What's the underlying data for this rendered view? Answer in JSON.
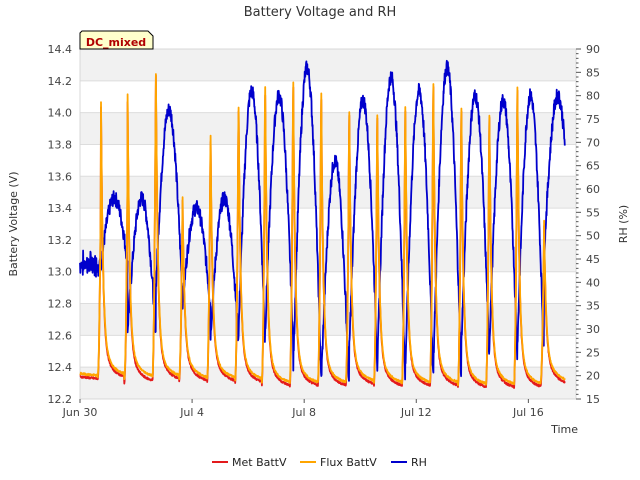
{
  "chart_data": {
    "type": "line",
    "title": "Battery Voltage and RH",
    "badge": "DC_mixed",
    "xlabel": "Time",
    "ylabel_left": "Battery Voltage (V)",
    "ylabel_right": "RH (%)",
    "x_ticks": [
      "Jun 30",
      "Jul 4",
      "Jul 8",
      "Jul 12",
      "Jul 16"
    ],
    "x_tick_days": [
      0,
      4,
      8,
      12,
      16
    ],
    "xlim_days": [
      0,
      17.7
    ],
    "ylim_left": [
      12.2,
      14.4
    ],
    "yticks_left": [
      "12.2",
      "12.4",
      "12.6",
      "12.8",
      "13.0",
      "13.2",
      "13.4",
      "13.6",
      "13.8",
      "14.0",
      "14.2",
      "14.4"
    ],
    "ylim_right": [
      15,
      90
    ],
    "yticks_right": [
      "15",
      "20",
      "25",
      "30",
      "35",
      "40",
      "45",
      "50",
      "55",
      "60",
      "65",
      "70",
      "75",
      "80",
      "85",
      "90"
    ],
    "grid": "horizontal, alternating bands",
    "legend_position": "bottom",
    "daily_peak_days": [
      0.75,
      1.7,
      2.7,
      3.65,
      4.65,
      5.65,
      6.6,
      7.6,
      8.6,
      9.6,
      10.6,
      11.6,
      12.6,
      13.6,
      14.6,
      15.6,
      16.55
    ],
    "series": [
      {
        "name": "Met BattV",
        "color": "#e31a1c",
        "axis": "left",
        "daily_peak_voltage": [
          13.82,
          13.85,
          14.28,
          13.38,
          13.8,
          14.02,
          14.15,
          14.2,
          14.12,
          14.0,
          13.98,
          14.03,
          14.2,
          14.03,
          13.98,
          14.18,
          13.2
        ],
        "daily_min_voltage": [
          12.32,
          12.3,
          12.31,
          12.3,
          12.3,
          12.29,
          12.27,
          12.27,
          12.27,
          12.28,
          12.27,
          12.27,
          12.27,
          12.26,
          12.26,
          12.26,
          12.28
        ]
      },
      {
        "name": "Flux BattV",
        "color": "#ffa500",
        "axis": "left",
        "daily_peak_voltage": [
          13.85,
          13.89,
          14.29,
          13.4,
          13.85,
          14.05,
          14.2,
          14.24,
          14.15,
          14.02,
          14.0,
          14.06,
          14.23,
          14.05,
          14.0,
          14.2,
          13.23
        ],
        "daily_min_voltage": [
          12.34,
          12.33,
          12.33,
          12.32,
          12.32,
          12.31,
          12.29,
          12.29,
          12.29,
          12.3,
          12.29,
          12.29,
          12.29,
          12.28,
          12.28,
          12.28,
          12.3
        ]
      },
      {
        "name": "RH",
        "color": "#0000cc",
        "axis": "right",
        "daily_max_rh": [
          48,
          58,
          58,
          77,
          56,
          58,
          81,
          80,
          86,
          66,
          79,
          84,
          81,
          86,
          80,
          79,
          80
        ],
        "daily_min_rh": [
          44,
          30,
          38,
          35,
          28,
          28,
          28,
          20,
          18,
          24,
          20,
          20,
          20,
          25,
          25,
          25,
          45
        ]
      }
    ]
  }
}
